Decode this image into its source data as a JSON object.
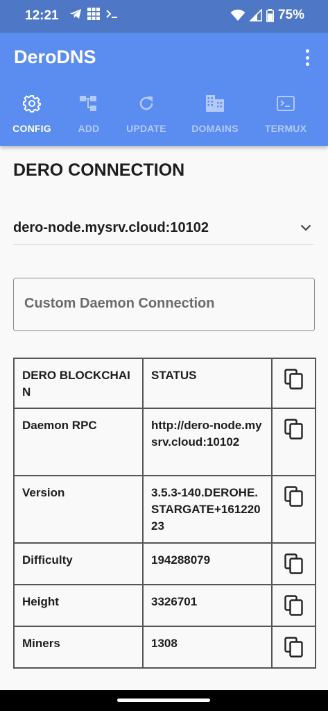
{
  "status_bar": {
    "time": "12:21",
    "battery": "75%"
  },
  "app": {
    "title": "DeroDNS"
  },
  "tabs": [
    {
      "label": "CONFIG",
      "icon": "gear-icon"
    },
    {
      "label": "ADD",
      "icon": "hierarchy-icon"
    },
    {
      "label": "UPDATE",
      "icon": "refresh-icon"
    },
    {
      "label": "DOMAINS",
      "icon": "building-icon"
    },
    {
      "label": "TERMUX",
      "icon": "terminal-icon"
    }
  ],
  "section": {
    "title": "DERO CONNECTION"
  },
  "node_select": {
    "value": "dero-node.mysrv.cloud:10102"
  },
  "custom_daemon": {
    "placeholder": "Custom Daemon Connection"
  },
  "table": {
    "header": [
      "DERO BLOCKCHAIN",
      "STATUS"
    ],
    "rows": [
      [
        "Daemon RPC",
        "http://dero-node.mysrv.cloud:10102"
      ],
      [
        "Version",
        "3.5.3-140.DEROHE.STARGATE+16122023"
      ],
      [
        "Difficulty",
        "194288079"
      ],
      [
        "Height",
        "3326701"
      ],
      [
        "Miners",
        "1308"
      ]
    ]
  },
  "colors": {
    "status_bar": "#4e78c6",
    "app_bar": "#5b8cef",
    "inactive_tab": "#b3c9f6"
  }
}
